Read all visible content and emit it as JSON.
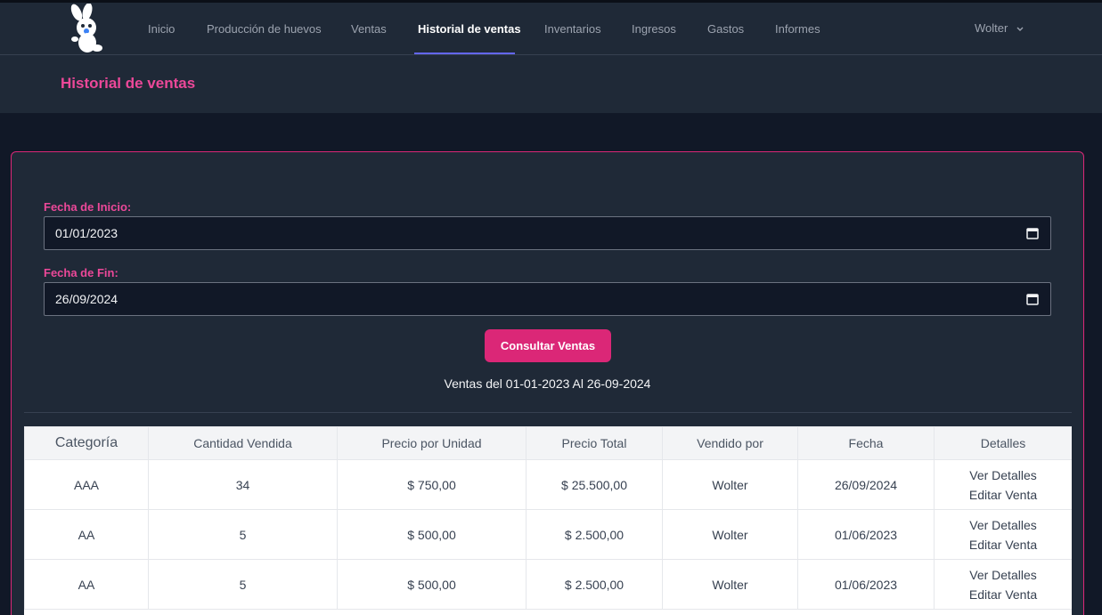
{
  "nav": {
    "items": [
      {
        "label": "Inicio",
        "active": false
      },
      {
        "label": "Producción de huevos",
        "active": false
      },
      {
        "label": "Ventas",
        "active": false
      },
      {
        "label": "Historial de ventas",
        "active": true
      },
      {
        "label": "Inventarios",
        "active": false
      },
      {
        "label": "Ingresos",
        "active": false
      },
      {
        "label": "Gastos",
        "active": false
      },
      {
        "label": "Informes",
        "active": false
      }
    ],
    "user": "Wolter",
    "logo_icon": "rabbit-mascot-icon"
  },
  "header": {
    "title": "Historial de ventas"
  },
  "filters": {
    "start_label": "Fecha de Inicio:",
    "start_value": "01/01/2023",
    "end_label": "Fecha de Fin:",
    "end_value": "26/09/2024",
    "submit_label": "Consultar Ventas",
    "range_text": "Ventas del 01-01-2023 Al 26-09-2024"
  },
  "table": {
    "headers": [
      "Categoría",
      "Cantidad Vendida",
      "Precio por Unidad",
      "Precio Total",
      "Vendido por",
      "Fecha",
      "Detalles"
    ],
    "rows": [
      {
        "categoria": "AAA",
        "cantidad": "34",
        "precio_unidad": "$ 750,00",
        "precio_total": "$ 25.500,00",
        "vendido_por": "Wolter",
        "fecha": "26/09/2024",
        "ver": "Ver Detalles",
        "editar": "Editar Venta"
      },
      {
        "categoria": "AA",
        "cantidad": "5",
        "precio_unidad": "$ 500,00",
        "precio_total": "$ 2.500,00",
        "vendido_por": "Wolter",
        "fecha": "01/06/2023",
        "ver": "Ver Detalles",
        "editar": "Editar Venta"
      },
      {
        "categoria": "AA",
        "cantidad": "5",
        "precio_unidad": "$ 500,00",
        "precio_total": "$ 2.500,00",
        "vendido_por": "Wolter",
        "fecha": "01/06/2023",
        "ver": "Ver Detalles",
        "editar": "Editar Venta"
      }
    ]
  },
  "colors": {
    "accent": "#ec4899",
    "button": "#db2777",
    "nav_active_underline": "#6366f1",
    "background": "#111827",
    "surface": "#1f2937"
  }
}
